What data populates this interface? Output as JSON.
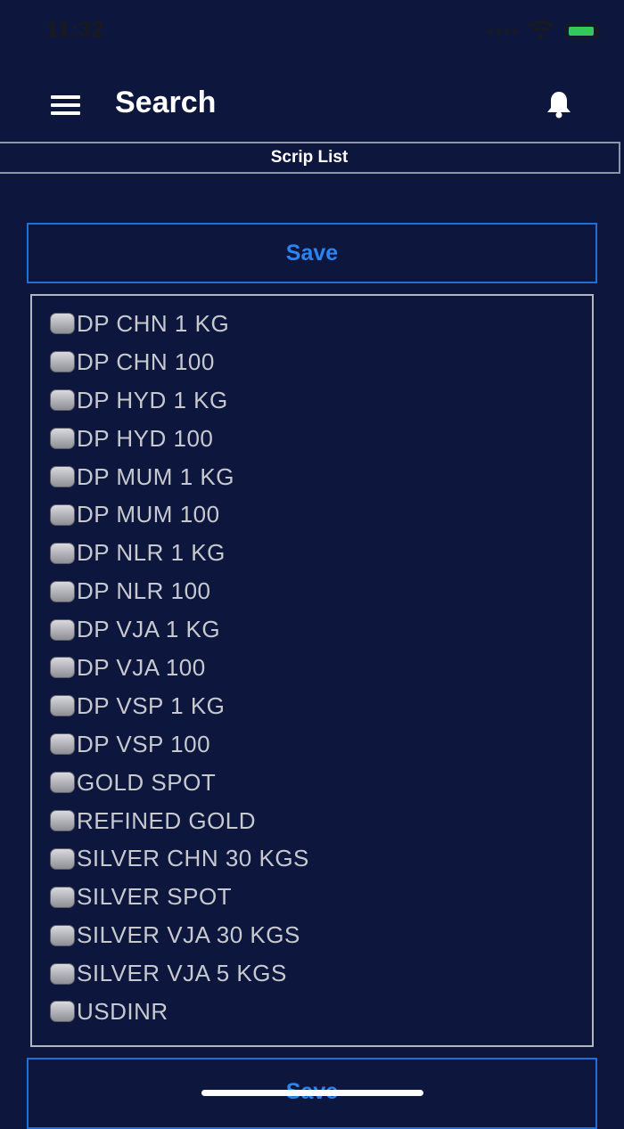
{
  "status_bar": {
    "time": "11:32"
  },
  "header": {
    "title": "Search"
  },
  "tab": {
    "label": "Scrip List"
  },
  "actions": {
    "save_label": "Save"
  },
  "scrips": [
    "DP CHN 1 KG",
    "DP CHN 100",
    "DP HYD 1 KG",
    "DP HYD 100",
    "DP MUM 1 KG",
    "DP MUM 100",
    "DP NLR 1 KG",
    "DP NLR 100",
    "DP VJA 1 KG",
    "DP VJA 100",
    "DP VSP 1 KG",
    "DP VSP 100",
    "GOLD SPOT",
    "REFINED GOLD",
    "SILVER CHN 30 KGS",
    "SILVER SPOT",
    "SILVER VJA 30 KGS",
    "SILVER VJA 5 KGS",
    "USDINR"
  ],
  "colors": {
    "background": "#0d173d",
    "accent": "#2b84f0"
  }
}
